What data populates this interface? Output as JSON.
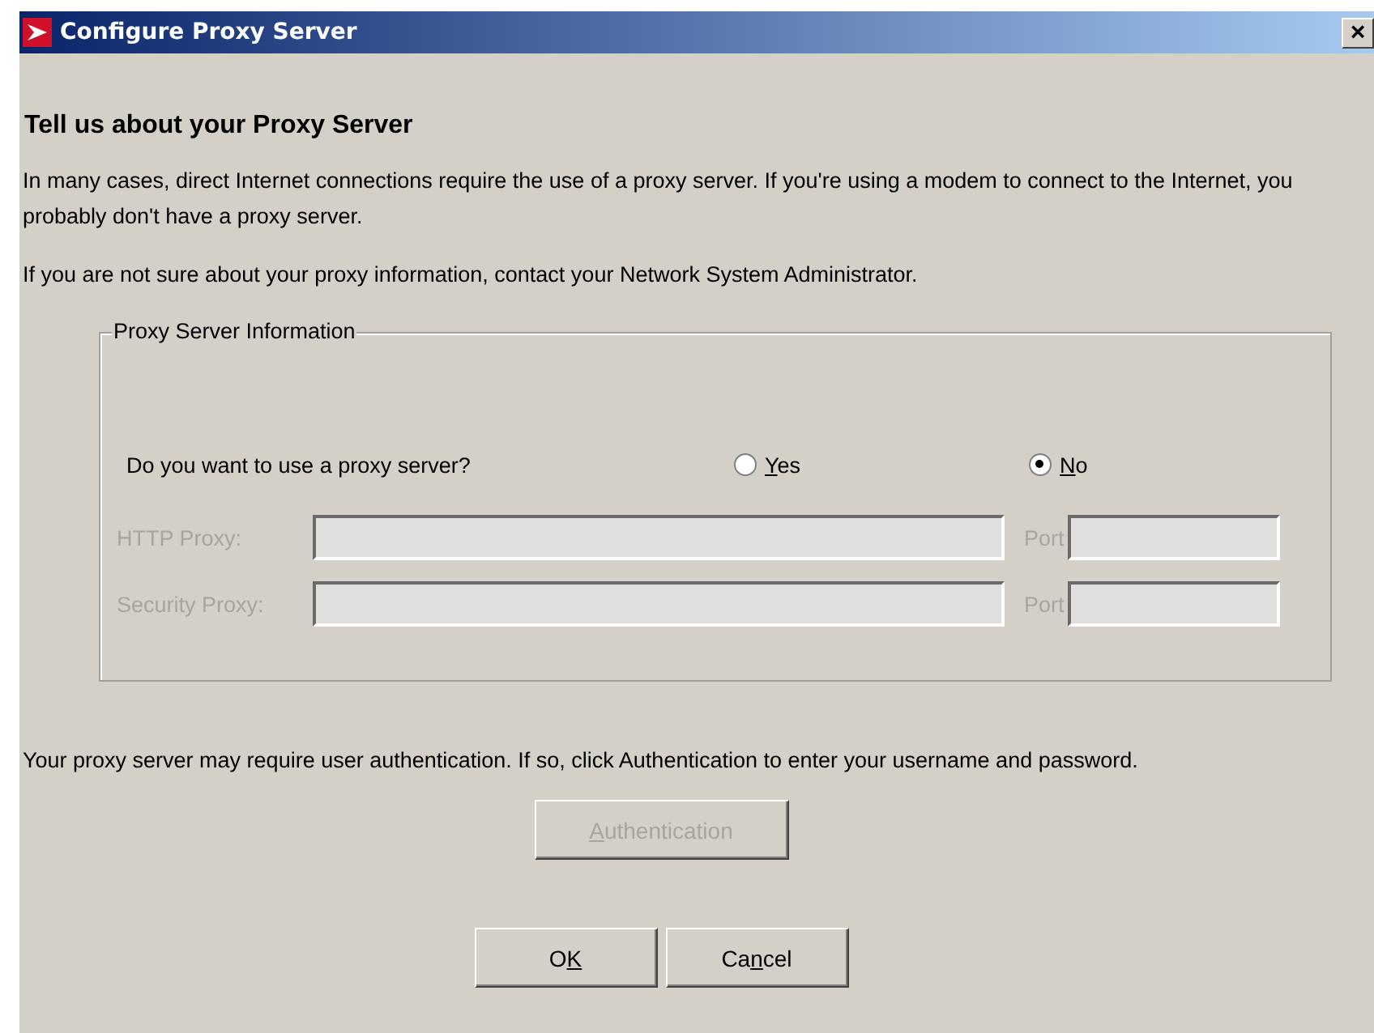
{
  "window": {
    "title": "Configure Proxy Server",
    "close": "×"
  },
  "heading": "Tell us about your Proxy Server",
  "paragraphs": [
    "In many cases, direct Internet connections require the use of a proxy server.  If you're using a modem to connect to the Internet, you probably don't have a proxy server.",
    "If you are not sure about your proxy information, contact your Network System Administrator."
  ],
  "group": {
    "legend": "Proxy Server Information",
    "question": "Do you want to use a proxy server?",
    "options": [
      {
        "key": "Y",
        "post": "es",
        "selected": false
      },
      {
        "key": "N",
        "post": "o",
        "selected": true
      }
    ],
    "rows": [
      {
        "label": "HTTP Proxy:",
        "port_label": "Port",
        "disabled": true
      },
      {
        "label": "Security Proxy:",
        "port_label": "Port",
        "disabled": true
      }
    ]
  },
  "auth_text": "Your proxy server may require user authentication.  If so, click Authentication to enter your username and password.",
  "auth_button": {
    "key": "A",
    "post": "uthentication",
    "disabled": true
  },
  "buttons": [
    {
      "pre": "O",
      "key": "K",
      "disabled": false
    },
    {
      "pre": "Ca",
      "key": "n",
      "post": "cel",
      "disabled": false
    }
  ]
}
